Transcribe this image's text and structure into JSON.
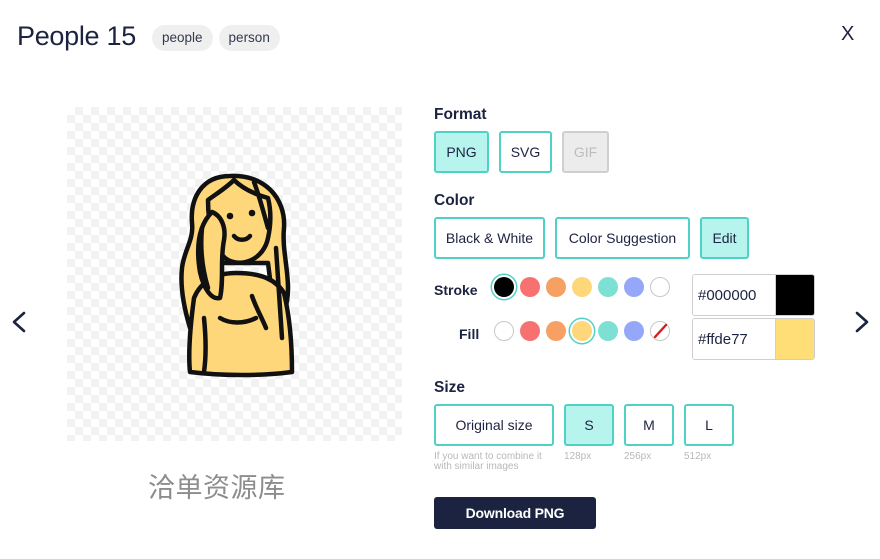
{
  "header": {
    "title": "People 15",
    "tags": [
      "people",
      "person"
    ],
    "close_label": "X"
  },
  "navigation": {
    "prev_icon": "chevron-left-icon",
    "next_icon": "chevron-right-icon"
  },
  "preview": {
    "watermark": "洽单资源库"
  },
  "format": {
    "label": "Format",
    "options": [
      {
        "label": "PNG",
        "state": "active"
      },
      {
        "label": "SVG",
        "state": "default"
      },
      {
        "label": "GIF",
        "state": "disabled"
      }
    ]
  },
  "color": {
    "label": "Color",
    "options": [
      {
        "label": "Black & White",
        "state": "default"
      },
      {
        "label": "Color Suggestion",
        "state": "default"
      },
      {
        "label": "Edit",
        "state": "active"
      }
    ],
    "stroke": {
      "label": "Stroke",
      "swatches": [
        "#000000",
        "#f87171",
        "#f6a063",
        "#fdd77a",
        "#7ee0d2",
        "#95a7f8",
        "#ffffff"
      ],
      "selected": "#000000",
      "hex_value": "#000000"
    },
    "fill": {
      "label": "Fill",
      "swatches": [
        "#ffffff",
        "#f87171",
        "#f6a063",
        "#fdd77a",
        "#7ee0d2",
        "#95a7f8",
        "none"
      ],
      "selected": "#fdd77a",
      "hex_value": "#ffde77"
    }
  },
  "size": {
    "label": "Size",
    "options": [
      {
        "label": "Original size",
        "hint": "If you want to combine it with similar images",
        "state": "default"
      },
      {
        "label": "S",
        "hint": "128px",
        "state": "active"
      },
      {
        "label": "M",
        "hint": "256px",
        "state": "default"
      },
      {
        "label": "L",
        "hint": "512px",
        "state": "default"
      }
    ]
  },
  "download": {
    "label": "Download PNG"
  },
  "colors": {
    "accent": "#4fd1c5",
    "accent_fill": "#b6f4ed",
    "navy": "#1c2340"
  }
}
